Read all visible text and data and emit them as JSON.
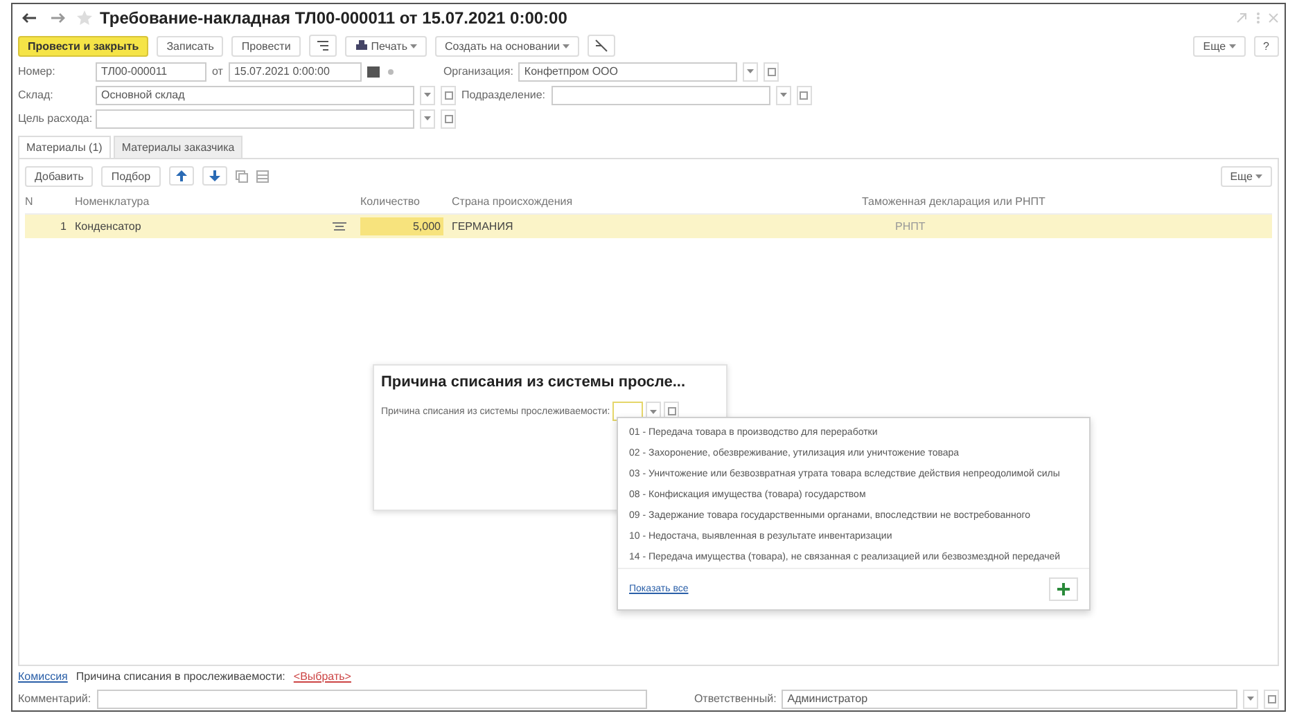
{
  "window": {
    "title": "Требование-накладная ТЛ00-000011 от 15.07.2021 0:00:00",
    "favorite": false
  },
  "toolbar": {
    "primary": "Провести и закрыть",
    "buttons": [
      "Записать",
      "Провести"
    ],
    "print": "Печать",
    "create_based": "Создать на основании",
    "more": "Еще",
    "help": "?"
  },
  "fields": {
    "number_label": "Номер:",
    "number": "ТЛ00-000011",
    "date_label": "от",
    "date": "15.07.2021  0:00:00",
    "org_label": "Организация:",
    "org": "Конфетпром ООО",
    "warehouse_label": "Склад:",
    "warehouse": "Основной склад",
    "dept_label": "Подразделение:",
    "purpose_label": "Цель расхода:"
  },
  "tabs": [
    {
      "label": "Материалы (1)",
      "selected": true
    },
    {
      "label": "Материалы заказчика",
      "selected": false
    }
  ],
  "table_toolbar": {
    "add": "Добавить",
    "pick": "Подбор",
    "more": "Еще"
  },
  "table": {
    "columns": [
      "N",
      "Номенклатура",
      "Количество",
      "Страна происхождения",
      "Таможенная декларация или РНПТ"
    ],
    "rows": [
      {
        "n": "1",
        "item": "Конденсатор",
        "qty": "5,000",
        "country": "ГЕРМАНИЯ",
        "declaration": "РНПТ",
        "selected": true
      }
    ]
  },
  "dialog": {
    "title": "Причина списания из системы просле...",
    "field_label": "Причина списания из системы прослеживаемости:"
  },
  "dropdown": {
    "items": [
      {
        "label": "01 - Передача товара в производство для переработки"
      },
      {
        "label": "02 - Захоронение, обезвреживание, утилизация или уничтожение товара"
      },
      {
        "label": "03 - Уничтожение или безвозвратная утрата товара вследствие действия непреодолимой силы"
      },
      {
        "label": "08 - Конфискация имущества (товара) государством"
      },
      {
        "label": "09 - Задержание товара государственными органами, впоследствии не востребованного"
      },
      {
        "label": "10 - Недостача, выявленная в результате инвентаризации"
      },
      {
        "label": "14 - Передача имущества (товара), не связанная с реализацией или безвозмездной передачей"
      }
    ],
    "show_all": "Показать все"
  },
  "footer": {
    "commission_link": "Комиссия",
    "reason_label": "Причина списания в прослеживаемости:",
    "choose_link": "<Выбрать>",
    "comment_label": "Комментарий:",
    "responsible_label": "Ответственный:",
    "responsible": "Администратор"
  }
}
